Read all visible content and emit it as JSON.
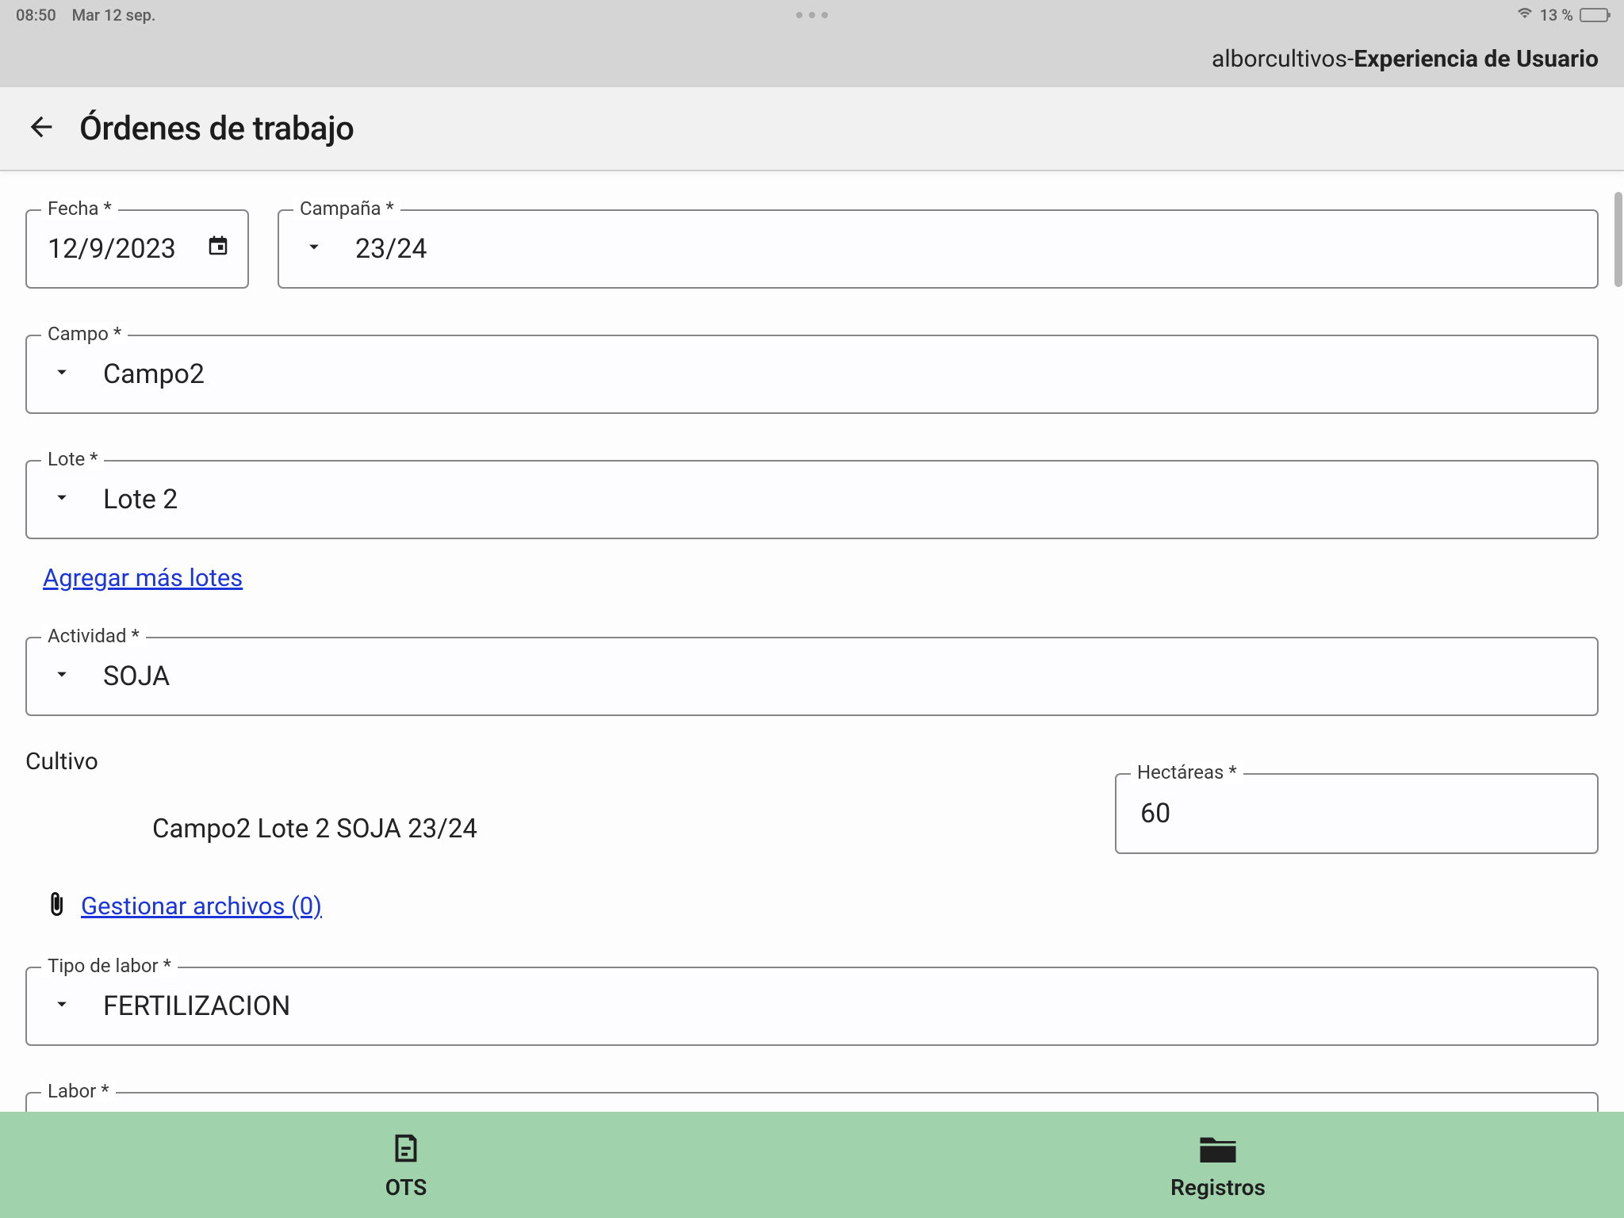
{
  "status": {
    "time": "08:50",
    "date": "Mar 12 sep.",
    "battery_pct": "13 %"
  },
  "header": {
    "brand": "alborcultivos",
    "separator": " - ",
    "subtitle": "Experiencia de Usuario"
  },
  "page": {
    "title": "Órdenes de trabajo"
  },
  "fields": {
    "fecha": {
      "label": "Fecha *",
      "value": "12/9/2023"
    },
    "campana": {
      "label": "Campaña *",
      "value": "23/24"
    },
    "campo": {
      "label": "Campo *",
      "value": "Campo2"
    },
    "lote": {
      "label": "Lote *",
      "value": "Lote 2"
    },
    "add_lotes_link": "Agregar más lotes",
    "actividad": {
      "label": "Actividad *",
      "value": "SOJA"
    },
    "cultivo": {
      "label": "Cultivo",
      "value": "Campo2 Lote 2 SOJA 23/24"
    },
    "hectareas": {
      "label": "Hectáreas *",
      "value": "60"
    },
    "manage_files_link": "Gestionar archivos (0)",
    "tipo_labor": {
      "label": "Tipo de labor *",
      "value": "FERTILIZACION"
    },
    "labor": {
      "label": "Labor *",
      "value": ""
    }
  },
  "nav": {
    "ots": "OTS",
    "registros": "Registros"
  }
}
